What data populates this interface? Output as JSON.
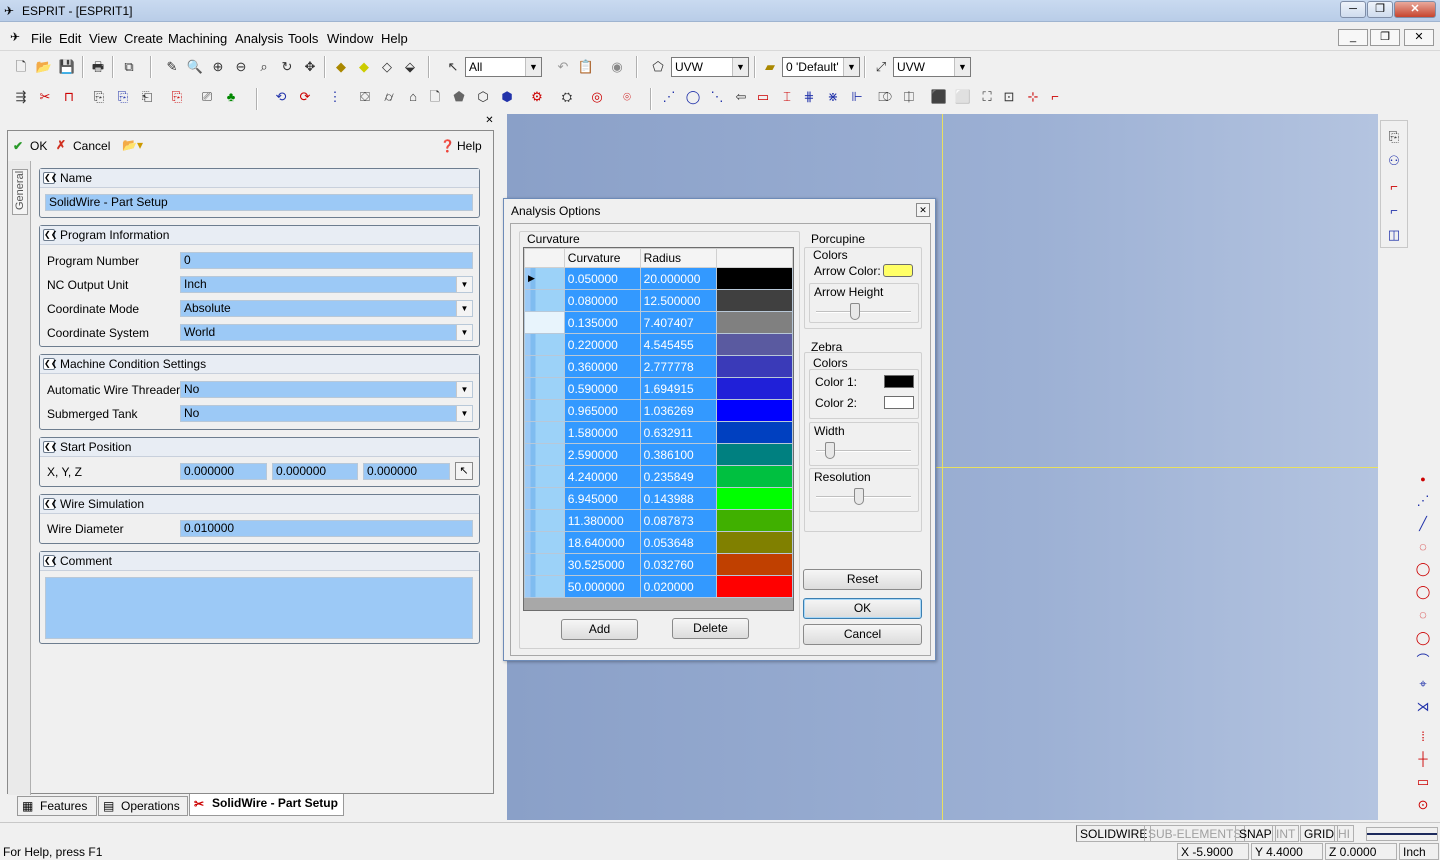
{
  "window": {
    "title": "ESPRIT - [ESPRIT1]"
  },
  "menu": [
    "File",
    "Edit",
    "View",
    "Create",
    "Machining",
    "Analysis",
    "Tools",
    "Window",
    "Help"
  ],
  "toolbar": {
    "select_filter": "All",
    "wp_combo1": "UVW",
    "layer_combo": "0 'Default'",
    "wp_combo2": "UVW"
  },
  "left_panel": {
    "ok_label": "OK",
    "cancel_label": "Cancel",
    "help_label": "Help",
    "side_tab": "General",
    "groups": {
      "name": {
        "title": "Name",
        "value": "SolidWire - Part Setup"
      },
      "program": {
        "title": "Program Information",
        "program_number_label": "Program Number",
        "program_number": "0",
        "nc_unit_label": "NC Output Unit",
        "nc_unit": "Inch",
        "coord_mode_label": "Coordinate Mode",
        "coord_mode": "Absolute",
        "coord_system_label": "Coordinate System",
        "coord_system": "World"
      },
      "machine": {
        "title": "Machine Condition Settings",
        "wire_threader_label": "Automatic Wire Threader",
        "wire_threader": "No",
        "submerged_label": "Submerged Tank",
        "submerged": "No"
      },
      "start": {
        "title": "Start Position",
        "xyz_label": "X, Y, Z",
        "x": "0.000000",
        "y": "0.000000",
        "z": "0.000000"
      },
      "wire": {
        "title": "Wire Simulation",
        "diameter_label": "Wire Diameter",
        "diameter": "0.010000"
      },
      "comment": {
        "title": "Comment",
        "value": ""
      }
    },
    "tabs": [
      "Features",
      "Operations",
      "SolidWire - Part Setup"
    ]
  },
  "dialog": {
    "title": "Analysis Options",
    "curvature_group": "Curvature",
    "col_curvature": "Curvature",
    "col_radius": "Radius",
    "rows": [
      {
        "curvature": "0.050000",
        "radius": "20.000000",
        "color": "#000000"
      },
      {
        "curvature": "0.080000",
        "radius": "12.500000",
        "color": "#404040"
      },
      {
        "curvature": "0.135000",
        "radius": "7.407407",
        "color": "#808080"
      },
      {
        "curvature": "0.220000",
        "radius": "4.545455",
        "color": "#5a5aa0"
      },
      {
        "curvature": "0.360000",
        "radius": "2.777778",
        "color": "#3a3ab8"
      },
      {
        "curvature": "0.590000",
        "radius": "1.694915",
        "color": "#2020d8"
      },
      {
        "curvature": "0.965000",
        "radius": "1.036269",
        "color": "#0000ff"
      },
      {
        "curvature": "1.580000",
        "radius": "0.632911",
        "color": "#0040c0"
      },
      {
        "curvature": "2.590000",
        "radius": "0.386100",
        "color": "#008080"
      },
      {
        "curvature": "4.240000",
        "radius": "0.235849",
        "color": "#00c040"
      },
      {
        "curvature": "6.945000",
        "radius": "0.143988",
        "color": "#00ff00"
      },
      {
        "curvature": "11.380000",
        "radius": "0.087873",
        "color": "#40b000"
      },
      {
        "curvature": "18.640000",
        "radius": "0.053648",
        "color": "#808000"
      },
      {
        "curvature": "30.525000",
        "radius": "0.032760",
        "color": "#c04000"
      },
      {
        "curvature": "50.000000",
        "radius": "0.020000",
        "color": "#ff0000"
      }
    ],
    "add_label": "Add",
    "delete_label": "Delete",
    "porcupine_title": "Porcupine",
    "porcupine_colors": "Colors",
    "arrow_color_label": "Arrow Color:",
    "arrow_color": "#ffff66",
    "arrow_height_label": "Arrow Height",
    "arrow_height_level": 0.4,
    "zebra_title": "Zebra",
    "zebra_colors": "Colors",
    "color1_label": "Color 1:",
    "color1": "#000000",
    "color2_label": "Color 2:",
    "color2": "#ffffff",
    "width_label": "Width",
    "width_level": 0.1,
    "resolution_label": "Resolution",
    "resolution_level": 0.45,
    "reset_label": "Reset",
    "ok_label": "OK",
    "cancel_label": "Cancel"
  },
  "status": {
    "help_text": "For Help, press F1",
    "modes": [
      "SOLIDWIRE",
      "SUB-ELEMENTS",
      "SNAP",
      "INT",
      "GRID",
      "HI"
    ],
    "x": "X -5.9000",
    "y": "Y 4.4000",
    "z": "Z 0.0000",
    "unit": "Inch"
  }
}
